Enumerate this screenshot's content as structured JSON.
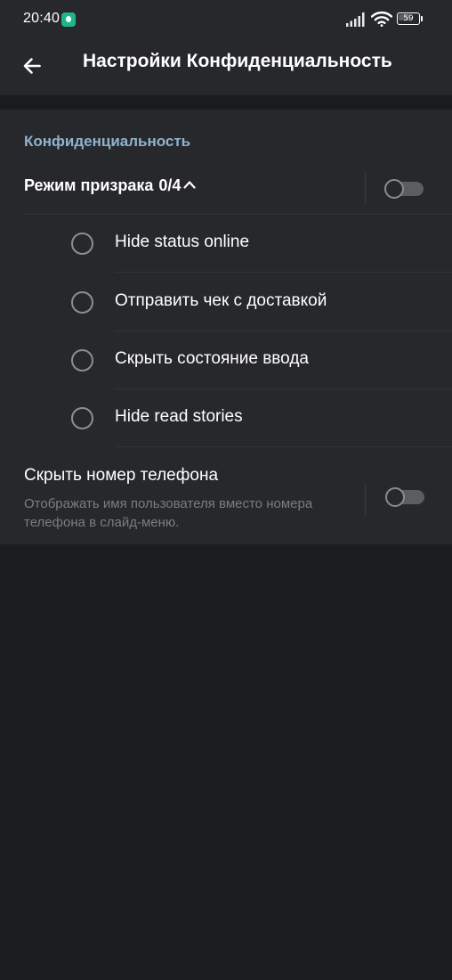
{
  "status_bar": {
    "time": "20:40",
    "battery_level": "59",
    "icons": [
      "app-notification-icon",
      "signal-icon",
      "wifi-icon",
      "battery-icon"
    ]
  },
  "app_bar": {
    "back_icon": "back-arrow-icon",
    "title": "Настройки Конфиденциальность"
  },
  "privacy": {
    "section_title": "Конфиденциальность",
    "ghost_mode": {
      "label": "Режим призрака",
      "count": "0/4",
      "expanded": true,
      "enabled": false,
      "options": [
        {
          "label": "Hide status online",
          "checked": false
        },
        {
          "label": "Отправить чек с доставкой",
          "checked": false
        },
        {
          "label": "Скрыть состояние ввода",
          "checked": false
        },
        {
          "label": "Hide read stories",
          "checked": false
        }
      ]
    },
    "hide_phone": {
      "title": "Скрыть номер телефона",
      "subtitle": "Отображать имя пользователя вместо номера телефона в слайд-меню.",
      "enabled": false
    }
  },
  "colors": {
    "background": "#1c1d20",
    "surface": "#27282c",
    "accent_text": "#8fb3cf",
    "secondary_text": "#7b7c80",
    "switch_off_track": "#5c5d61"
  }
}
